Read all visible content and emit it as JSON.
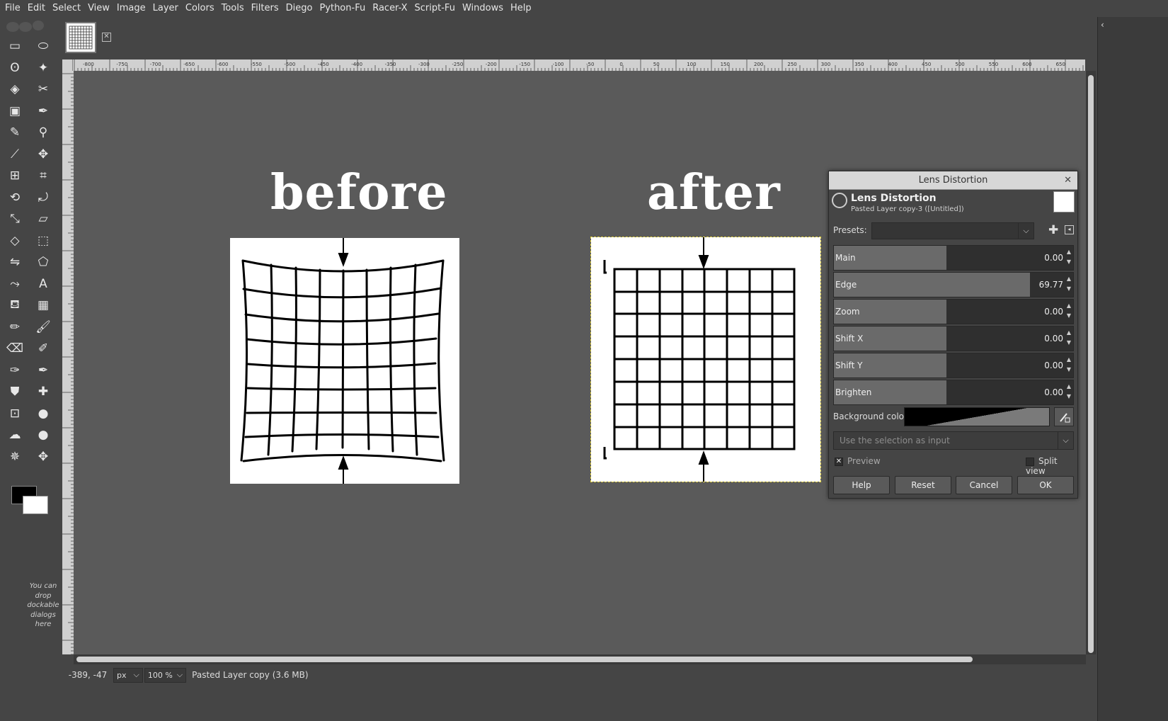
{
  "menubar": [
    "File",
    "Edit",
    "Select",
    "View",
    "Image",
    "Layer",
    "Colors",
    "Tools",
    "Filters",
    "Diego",
    "Python-Fu",
    "Racer-X",
    "Script-Fu",
    "Windows",
    "Help"
  ],
  "toolbox": {
    "drop_hint": "You can drop dockable dialogs here",
    "fg_color": "#000000",
    "bg_color": "#ffffff"
  },
  "ruler_labels": [
    "-800",
    "-750",
    "-700",
    "-650",
    "-600",
    "-550",
    "-500",
    "-450",
    "-400",
    "-350",
    "-300",
    "-250",
    "-200",
    "-150",
    "-100",
    "-50",
    "0",
    "50",
    "100",
    "150",
    "200",
    "250",
    "300",
    "350",
    "400",
    "450",
    "500",
    "550",
    "600",
    "650"
  ],
  "canvas": {
    "before_label": "before",
    "after_label": "after"
  },
  "status": {
    "coords": "-389, -47",
    "unit": "px",
    "zoom": "100 %",
    "layer_info": "Pasted Layer copy (3.6 MB)"
  },
  "dialog": {
    "title": "Lens Distortion",
    "heading": "Lens Distortion",
    "subheading": "Pasted Layer copy-3 ([Untitled])",
    "presets_label": "Presets:",
    "presets_value": "",
    "sliders": [
      {
        "label": "Main",
        "value": "0.00",
        "fraction": 0.47
      },
      {
        "label": "Edge",
        "value": "69.77",
        "fraction": 0.82
      },
      {
        "label": "Zoom",
        "value": "0.00",
        "fraction": 0.47
      },
      {
        "label": "Shift X",
        "value": "0.00",
        "fraction": 0.47
      },
      {
        "label": "Shift Y",
        "value": "0.00",
        "fraction": 0.47
      },
      {
        "label": "Brighten",
        "value": "0.00",
        "fraction": 0.47
      }
    ],
    "background_color_label": "Background color",
    "selection_input": "Use the selection as input",
    "preview_label": "Preview",
    "preview_checked": true,
    "split_view_label": "Split view",
    "split_view_checked": false,
    "buttons": {
      "help": "Help",
      "reset": "Reset",
      "cancel": "Cancel",
      "ok": "OK"
    }
  }
}
